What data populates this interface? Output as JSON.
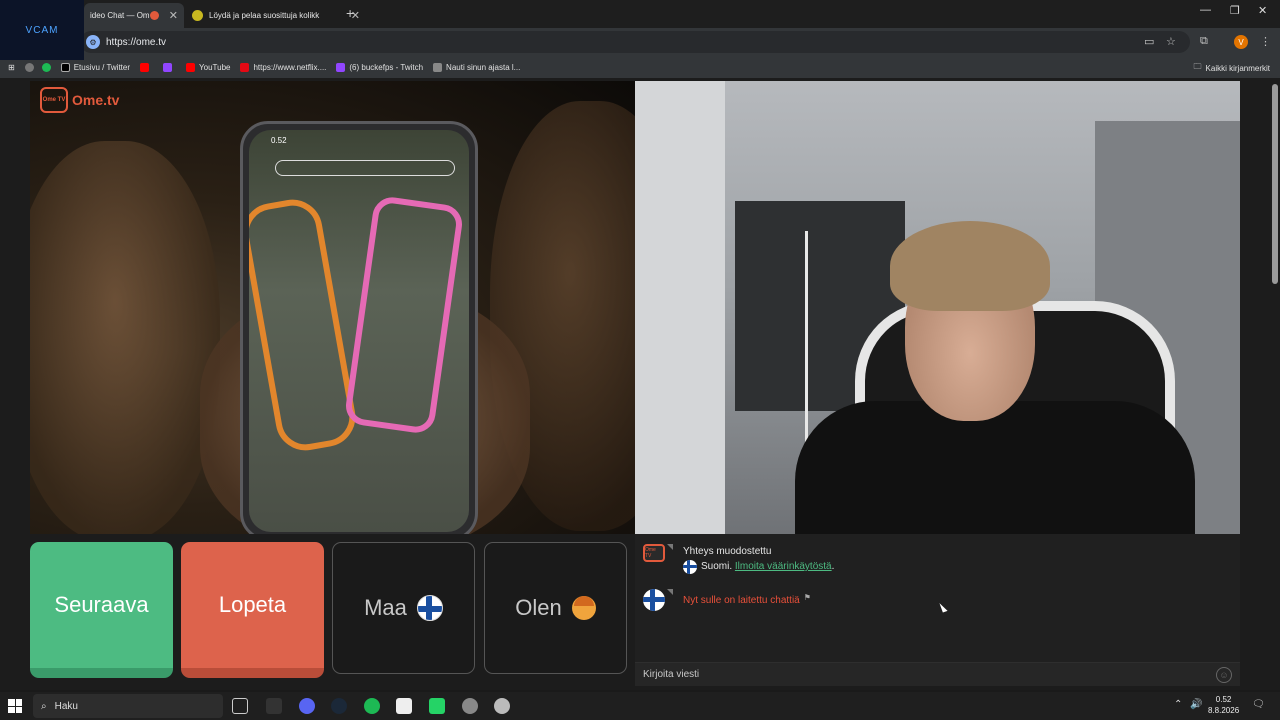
{
  "overlay": {
    "vcam_label": "VCAM"
  },
  "tabs": [
    {
      "title": "ideo Chat — Ome",
      "active": true
    },
    {
      "title": "Löydä ja pelaa suosittuja kolikk",
      "active": false
    }
  ],
  "address_bar": {
    "url": "https://ome.tv",
    "profile_initial": "V"
  },
  "bookmarks": {
    "items": [
      {
        "label": "Etusivu / Twitter",
        "color": "#000000"
      },
      {
        "label": "YouTube",
        "color": "#ff0000"
      },
      {
        "label": "https://www.netflix....",
        "color": "#e50914"
      },
      {
        "label": "(6) buckefps - Twitch",
        "color": "#9146ff"
      },
      {
        "label": "Nauti sinun ajasta l...",
        "color": "#888888"
      }
    ],
    "all_bookmarks": "Kaikki kirjanmerkit"
  },
  "app": {
    "logo_text": "Ome.tv",
    "logo_badge": "Ome TV",
    "phone_time": "0.52"
  },
  "controls": {
    "next_label": "Seuraava",
    "stop_label": "Lopeta",
    "country_label": "Maa",
    "gender_label": "Olen"
  },
  "chat": {
    "connected": "Yhteys muodostettu",
    "country": "Suomi.",
    "report_link": "Ilmoita väärinkäytöstä",
    "report_suffix": ".",
    "stranger_msg": "Nyt sulle on laitettu chattiä",
    "input_placeholder": "Kirjoita viesti"
  },
  "taskbar": {
    "search_placeholder": "Haku",
    "time": "0.52",
    "date": "8.8.2026"
  },
  "colors": {
    "next": "#4dbb82",
    "stop": "#dd634c",
    "brand": "#e25a3c"
  }
}
